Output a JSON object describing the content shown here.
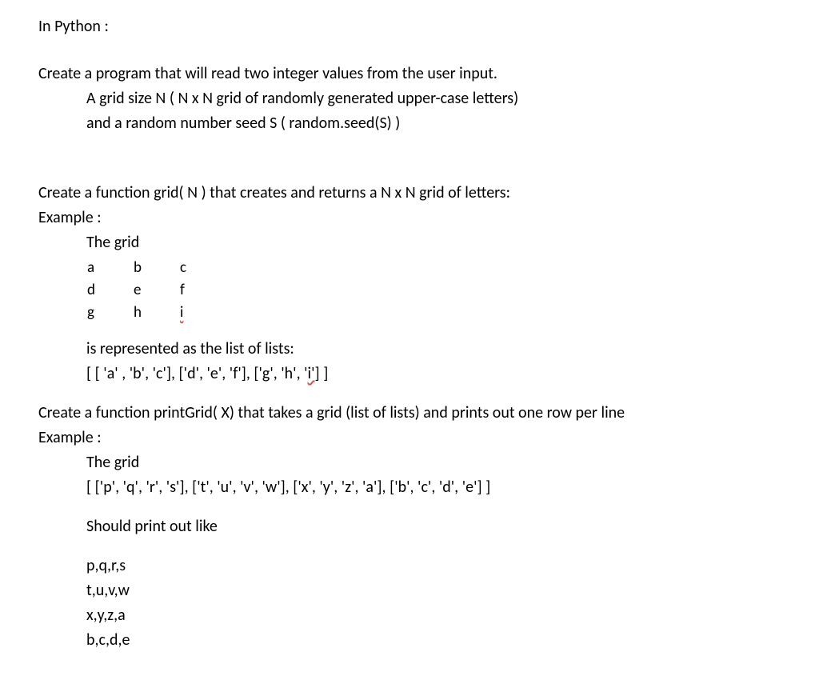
{
  "title": "In Python :",
  "intro_l1": "Create a program that will read two integer values from the user input.",
  "intro_l2": "A grid size N ( N x N grid of randomly generated upper-case letters)",
  "intro_l3": " and a random number seed S ( random.seed(S) )",
  "grid_fn_l1": "Create a function grid( N ) that creates and returns a N x N grid of letters:",
  "example_label": "Example :",
  "the_grid_label": "The grid",
  "grid_cells": {
    "r0": [
      "a",
      "b",
      "c"
    ],
    "r1": [
      "d",
      "e",
      "f"
    ],
    "r2": [
      "g",
      "h",
      "i"
    ]
  },
  "rep_l1": "is represented as the list of lists:",
  "rep_l2_pre": "[ [ 'a' ,  'b', 'c'], ['d', 'e', 'f'], ['g', 'h', '",
  "rep_l2_i": "i'",
  "rep_l2_post": "] ]",
  "print_fn_l1": "Create a function printGrid( X) that takes a grid (list of lists) and prints out one row per line",
  "print_grid_list": "[ ['p', 'q', 'r', 's'], ['t', 'u', 'v', 'w'], ['x', 'y', 'z', 'a'], ['b', 'c', 'd', 'e'] ]",
  "should_print": "Should print out like",
  "out_r0": "p,q,r,s",
  "out_r1": "t,u,v,w",
  "out_r2": "x,y,z,a",
  "out_r3": "b,c,d,e"
}
